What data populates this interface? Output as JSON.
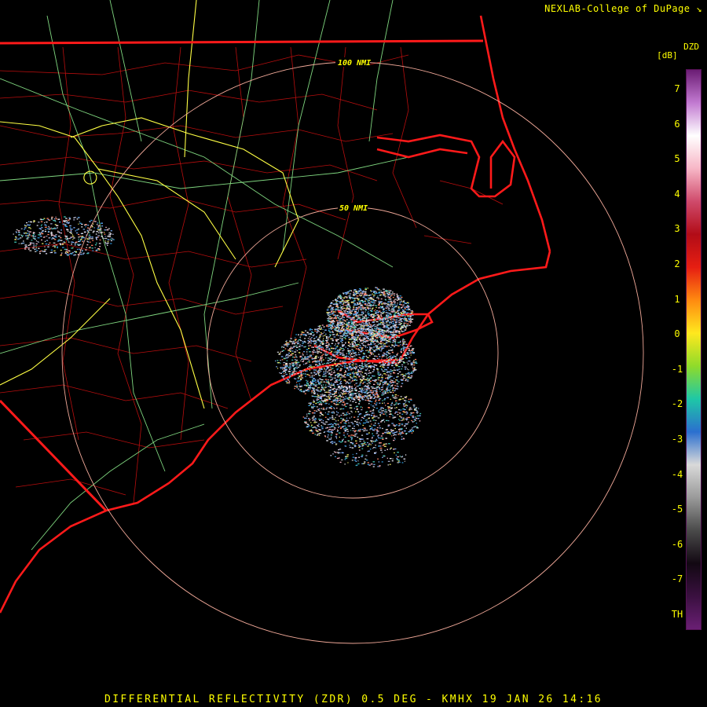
{
  "credit": "NEXLAB-College of DuPage",
  "credit_icon": "arrow-corner-icon",
  "footer": "DIFFERENTIAL REFLECTIVITY (ZDR) 0.5 DEG - KMHX 19 JAN 26 14:16",
  "legend": {
    "product": "DZD",
    "unit": "[dB]",
    "ticks": [
      "7",
      "6",
      "5",
      "4",
      "3",
      "2",
      "1",
      "0",
      "-1",
      "-2",
      "-3",
      "-4",
      "-5",
      "-6",
      "-7",
      "TH"
    ],
    "gradient": [
      "#6b1c74",
      "#c27ad1",
      "#ffffff",
      "#f7b6c6",
      "#cf4a6b",
      "#b20c17",
      "#e61e12",
      "#ff8a10",
      "#ffe81e",
      "#8fdb2a",
      "#1ec8a6",
      "#2b6fcf",
      "#d9d9d9",
      "#9a9a9a",
      "#4a4a4a",
      "#120812",
      "#3a1040",
      "#6a1f74"
    ]
  },
  "range_rings": [
    {
      "label": "100 NMI"
    },
    {
      "label": "50 NMI"
    }
  ],
  "colors": {
    "state_borders": "#ff1a1a",
    "county_borders": "#cc1010",
    "highways_major": "#ffff55",
    "highways_minor": "#88dd88",
    "range_rings": "#f4b0a0"
  }
}
